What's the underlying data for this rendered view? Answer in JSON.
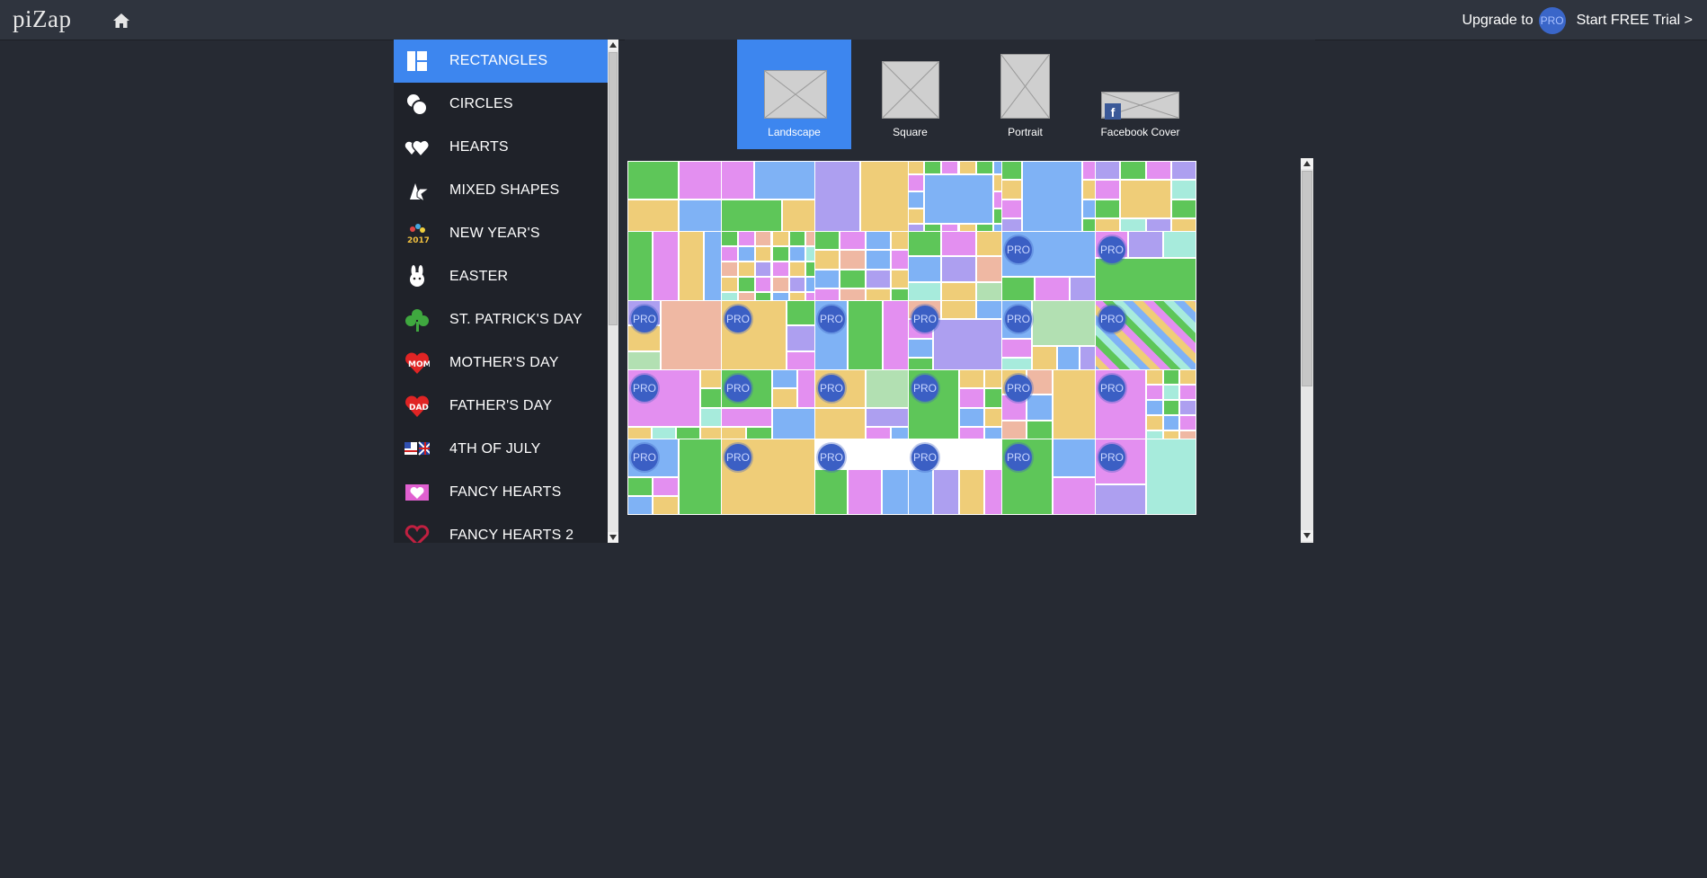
{
  "app": {
    "logo": "piZap"
  },
  "topbar": {
    "upgrade_label": "Upgrade to",
    "pro_badge": "PRO",
    "trial_label": "Start FREE Trial >"
  },
  "categories": [
    {
      "label": "RECTANGLES",
      "icon": "rectangles-icon",
      "active": true
    },
    {
      "label": "CIRCLES",
      "icon": "circles-icon"
    },
    {
      "label": "HEARTS",
      "icon": "hearts-icon"
    },
    {
      "label": "MIXED SHAPES",
      "icon": "mixed-shapes-icon"
    },
    {
      "label": "NEW YEAR'S",
      "icon": "new-years-icon",
      "icon_text": "2017"
    },
    {
      "label": "EASTER",
      "icon": "easter-bunny-icon"
    },
    {
      "label": "ST. PATRICK'S DAY",
      "icon": "shamrock-icon"
    },
    {
      "label": "MOTHER'S DAY",
      "icon": "mom-heart-icon",
      "icon_text": "MOM"
    },
    {
      "label": "FATHER'S DAY",
      "icon": "dad-heart-icon",
      "icon_text": "DAD"
    },
    {
      "label": "4TH OF JULY",
      "icon": "flag-icon"
    },
    {
      "label": "FANCY HEARTS",
      "icon": "fancy-hearts-icon"
    },
    {
      "label": "FANCY HEARTS 2",
      "icon": "fancy-hearts-2-icon"
    }
  ],
  "size_tabs": [
    {
      "label": "Landscape",
      "active": true
    },
    {
      "label": "Square"
    },
    {
      "label": "Portrait"
    },
    {
      "label": "Facebook Cover"
    }
  ],
  "colors": {
    "accent": "#3d86ef",
    "green": "#5ec659",
    "pink": "#e38ff0",
    "yellow": "#efcd78",
    "blue": "#7fb2f5",
    "lavender": "#ad9ff0",
    "salmon": "#efb8a3",
    "mint": "#a7ebdc",
    "sage": "#b2e0b2"
  },
  "layouts_pro_flags": [
    [
      false,
      false,
      false,
      false,
      false,
      false
    ],
    [
      false,
      false,
      false,
      false,
      true,
      true
    ],
    [
      true,
      true,
      true,
      true,
      true,
      true
    ],
    [
      true,
      true,
      true,
      true,
      true,
      true
    ],
    [
      true,
      true,
      true,
      true,
      true,
      true
    ]
  ]
}
